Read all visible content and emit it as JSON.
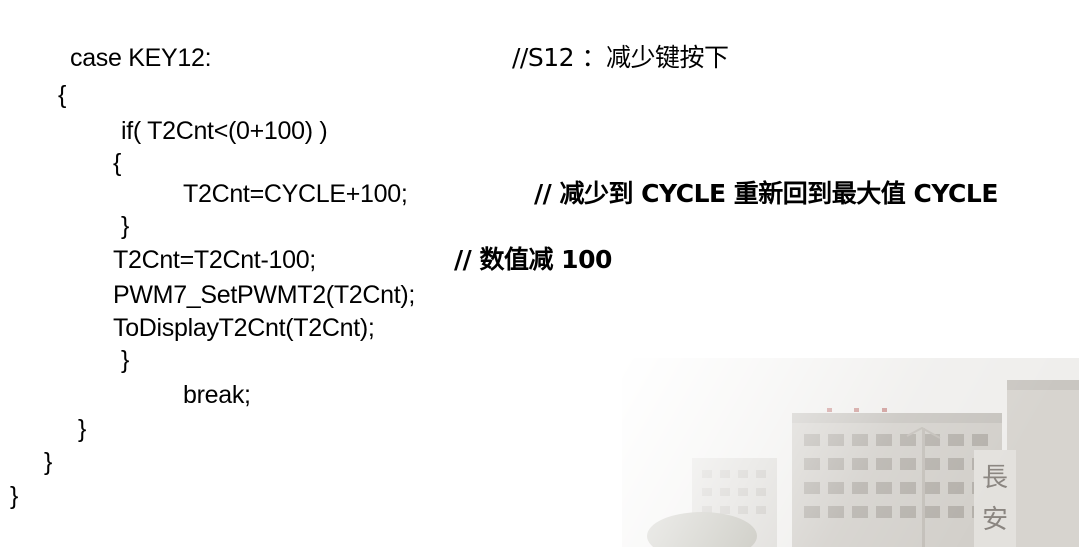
{
  "code": {
    "lines": [
      "case KEY12:",
      "{",
      "if( T2Cnt<(0+100) )",
      "{",
      "T2Cnt=CYCLE+100;",
      "}",
      "T2Cnt=T2Cnt-100;",
      "PWM7_SetPWMT2(T2Cnt);",
      "ToDisplayT2Cnt(T2Cnt);",
      "}",
      "break;",
      "}",
      "}",
      "}"
    ],
    "comments": [
      "//S12 ：减少键按下",
      "// 减少到 CYCLE 重新回到最大值 CYCLE",
      "// 数值减 100"
    ]
  },
  "photo": {
    "sign_chars": [
      "長",
      "安"
    ],
    "icon": "campus-building-photo"
  }
}
